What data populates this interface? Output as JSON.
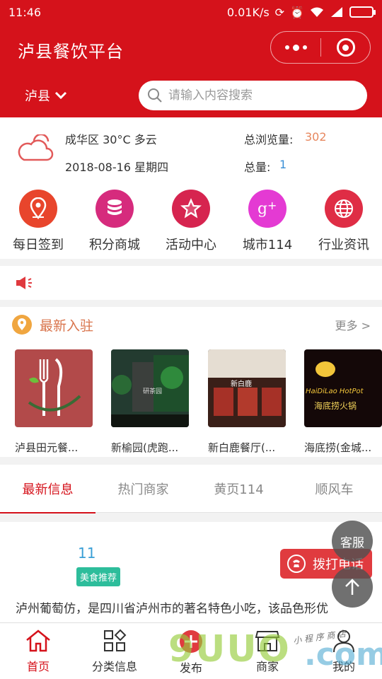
{
  "status_bar": {
    "time": "11:46",
    "speed": "0.01K/s"
  },
  "header": {
    "title": "泸县餐饮平台",
    "city": "泸县",
    "search_placeholder": "请输入内容搜索"
  },
  "info": {
    "weather": "成华区 30°C 多云",
    "date": "2018-08-16 星期四",
    "views_label": "总浏览量:",
    "views_value": "302",
    "total_label": "总量:",
    "total_value": "1"
  },
  "nav": [
    {
      "label": "每日签到",
      "icon": "location-pin-icon",
      "color": "#e8452c"
    },
    {
      "label": "积分商城",
      "icon": "database-icon",
      "color": "#d62b7d"
    },
    {
      "label": "活动中心",
      "icon": "star-icon",
      "color": "#d6244f"
    },
    {
      "label": "城市114",
      "icon": "google-plus-icon",
      "color": "#e43ad3"
    },
    {
      "label": "行业资讯",
      "icon": "globe-icon",
      "color": "#df2d45"
    }
  ],
  "newest": {
    "title": "最新入驻",
    "more": "更多 >",
    "items": [
      {
        "name": "泸县田元餐..."
      },
      {
        "name": "新榆园(虎跑..."
      },
      {
        "name": "新白鹿餐厅(..."
      },
      {
        "name": "海底捞(金城..."
      }
    ],
    "sign_text_2": "研茶园",
    "sign_text_3": "新白鹿",
    "sign_text_4a": "HaiDiLao HotPot",
    "sign_text_4b": "海底捞火锅"
  },
  "tabs": [
    "最新信息",
    "热门商家",
    "黄页114",
    "顺风车"
  ],
  "post": {
    "count": "11",
    "tag": "美食推荐",
    "call_label": "拨打电话",
    "description": "泸州葡萄仿，是四川省泸州市的著名特色小吃，该品色形优"
  },
  "floating": {
    "service": "客服"
  },
  "bottom_nav": [
    {
      "label": "首页",
      "icon": "home-icon"
    },
    {
      "label": "分类信息",
      "icon": "category-icon"
    },
    {
      "label": "发布",
      "icon": "plus-icon"
    },
    {
      "label": "商家",
      "icon": "shop-icon"
    },
    {
      "label": "我的",
      "icon": "user-icon"
    }
  ],
  "watermark": {
    "main": "9UUO",
    "suffix": ".com",
    "script": "小 程 序 商 店"
  },
  "colors": {
    "brand": "#d5121b",
    "accent_orange": "#e7875e",
    "accent_blue": "#3a8fd6",
    "tag_green": "#2dbd9b"
  }
}
